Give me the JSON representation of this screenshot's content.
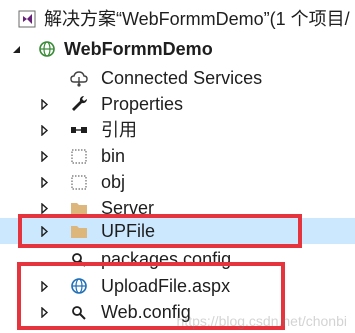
{
  "tree": {
    "solution_label": "解决方案“WebFormmDemo”(1 个项目/",
    "project_label": "WebFormmDemo",
    "items": [
      {
        "label": "Connected Services",
        "icon": "connected-services-icon"
      },
      {
        "label": "Properties",
        "icon": "wrench-icon"
      },
      {
        "label": "引用",
        "icon": "references-icon"
      },
      {
        "label": "bin",
        "icon": "dotted-folder-icon"
      },
      {
        "label": "obj",
        "icon": "dotted-folder-icon"
      },
      {
        "label": "Server",
        "icon": "folder-icon"
      },
      {
        "label": "UPFile",
        "icon": "folder-icon"
      },
      {
        "label": "packages.config",
        "icon": "config-icon"
      },
      {
        "label": "UploadFile.aspx",
        "icon": "globe-icon"
      },
      {
        "label": "Web.config",
        "icon": "config-icon"
      }
    ]
  },
  "watermark": "https://blog.csdn.net/chonbi",
  "colors": {
    "highlight_border": "#e5343e",
    "selection_bg": "#cce8ff",
    "folder": "#dcb67a"
  }
}
